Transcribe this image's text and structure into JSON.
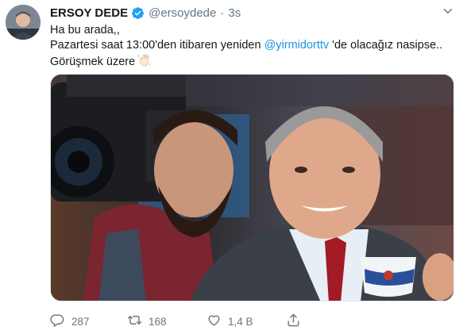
{
  "tweet": {
    "display_name": "ERSOY DEDE",
    "handle": "@ersoydede",
    "separator": "·",
    "time": "3s",
    "text_line1": "Ha bu arada,,",
    "text_line2_before": "Pazartesi saat 13:00'den itibaren yeniden ",
    "mention": "@yirmidorttv",
    "text_line2_after": " 'de olacağız nasipse..",
    "text_line3": "Görüşmek üzere",
    "emoji_icon": "waving-hand-emoji",
    "verified_icon": "verified-badge-icon",
    "verified_color": "#1da1f2",
    "mention_color": "#1b95e0"
  },
  "actions": {
    "reply_count": "287",
    "retweet_count": "168",
    "like_count": "1,4 B",
    "icons": [
      "reply-icon",
      "retweet-icon",
      "like-icon",
      "share-icon"
    ]
  }
}
